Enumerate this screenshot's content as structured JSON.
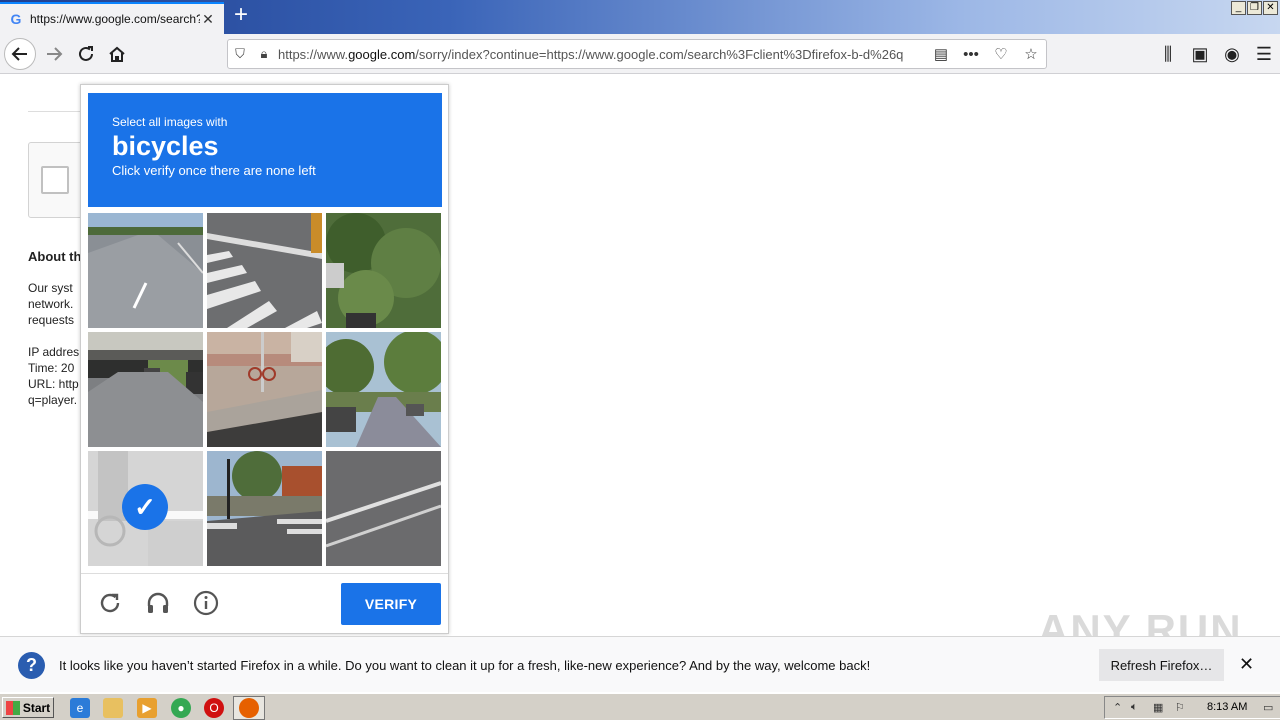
{
  "browser": {
    "tab_title": "https://www.google.com/search?c",
    "url_prefix": "https://www.",
    "url_domain": "google.com",
    "url_rest": "/sorry/index?continue=https://www.google.com/search%3Fclient%3Dfirefox-b-d%26q",
    "new_tab_label": "+"
  },
  "background_page": {
    "heading": "About th",
    "lines": [
      "Our syst",
      "network.",
      "requests",
      "IP addres",
      "Time: 20",
      "URL: http",
      "q=player."
    ]
  },
  "captcha": {
    "instruction_line1": "Select all images with",
    "target_object": "bicycles",
    "instruction_line3": "Click verify once there are none left",
    "verify_label": "VERIFY",
    "tiles": [
      {
        "scene": "highway road",
        "selected": false
      },
      {
        "scene": "crosswalk with car",
        "selected": false
      },
      {
        "scene": "trees",
        "selected": false
      },
      {
        "scene": "underpass with cars",
        "selected": false
      },
      {
        "scene": "sidewalk with bicycle",
        "selected": false
      },
      {
        "scene": "tree-lined street",
        "selected": false
      },
      {
        "scene": "cyclist",
        "selected": true
      },
      {
        "scene": "intersection",
        "selected": false
      },
      {
        "scene": "asphalt crosswalk",
        "selected": false
      }
    ],
    "colors": {
      "accent": "#1a73e8"
    }
  },
  "notification": {
    "message": "It looks like you haven’t started Firefox in a while. Do you want to clean it up for a fresh, like-new experience? And by the way, welcome back!",
    "button_label": "Refresh Firefox…"
  },
  "watermark": "ANY RUN",
  "taskbar": {
    "start_label": "Start",
    "clock": "8:13 AM"
  }
}
